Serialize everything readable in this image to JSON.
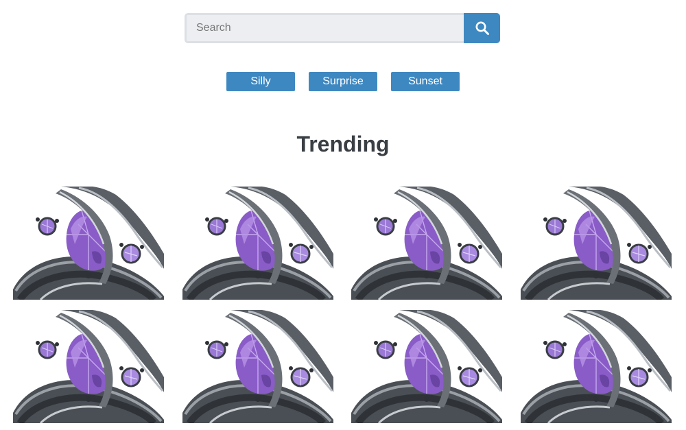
{
  "search": {
    "placeholder": "Search",
    "value": "",
    "icon": "search-icon"
  },
  "tags": [
    {
      "label": "Silly"
    },
    {
      "label": "Surprise"
    },
    {
      "label": "Sunset"
    }
  ],
  "section": {
    "title": "Trending"
  },
  "gallery": {
    "item_count": 8,
    "image_subject": "purple-gem-ring",
    "colors": {
      "gem": "#8a5cc8",
      "band": "#5a5f66",
      "accent": "#3e88c1"
    }
  }
}
